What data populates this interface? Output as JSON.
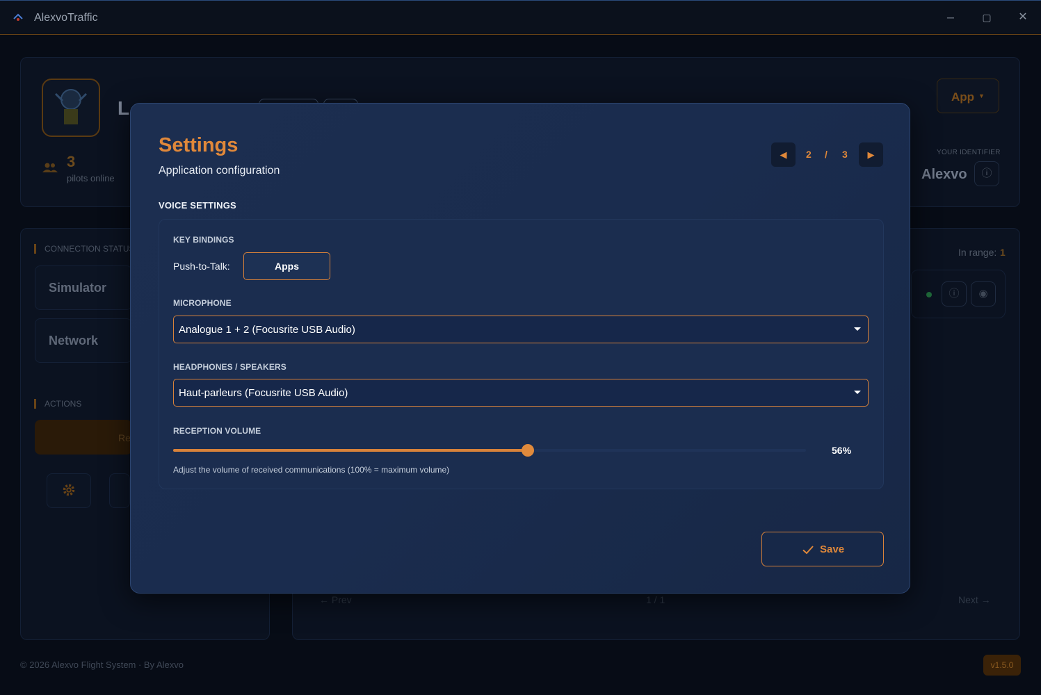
{
  "window": {
    "title": "AlexvoTraffic",
    "controls": {
      "minimize": "─",
      "maximize": "▢",
      "close": "✕"
    }
  },
  "background": {
    "user_name_partial": "L",
    "pilots_count": "3",
    "pilots_label": "pilots online",
    "app_button": "App",
    "identifier_label": "YOUR IDENTIFIER",
    "identifier_value": "Alexvo",
    "connection_status_label": "CONNECTION STATUS",
    "simulator_label": "Simulator",
    "network_label": "Network",
    "actions_label": "ACTIONS",
    "action_partial": "Re",
    "in_range_label": "In range:",
    "in_range_value": "1",
    "pager_prev": "← Prev",
    "pager_page": "1 / 1",
    "pager_next": "Next →",
    "footer": "© 2026 Alexvo Flight System · By Alexvo",
    "version": "v1.5.0"
  },
  "modal": {
    "title": "Settings",
    "subtitle": "Application configuration",
    "pager": {
      "current": "2",
      "separator": "/",
      "total": "3"
    },
    "section_label": "VOICE SETTINGS",
    "key_bindings": {
      "label": "KEY BINDINGS",
      "ptt_label": "Push-to-Talk:",
      "ptt_value": "Apps"
    },
    "microphone": {
      "label": "MICROPHONE",
      "value": "Analogue 1 + 2 (Focusrite USB Audio)"
    },
    "output": {
      "label": "HEADPHONES / SPEAKERS",
      "value": "Haut-parleurs (Focusrite USB Audio)"
    },
    "volume": {
      "label": "RECEPTION VOLUME",
      "value": 56,
      "value_text": "56%",
      "hint": "Adjust the volume of received communications (100% = maximum volume)"
    },
    "save_label": "Save"
  },
  "colors": {
    "accent": "#e0883a",
    "modal_bg": "#1c2e50",
    "app_bg": "#050a14"
  }
}
